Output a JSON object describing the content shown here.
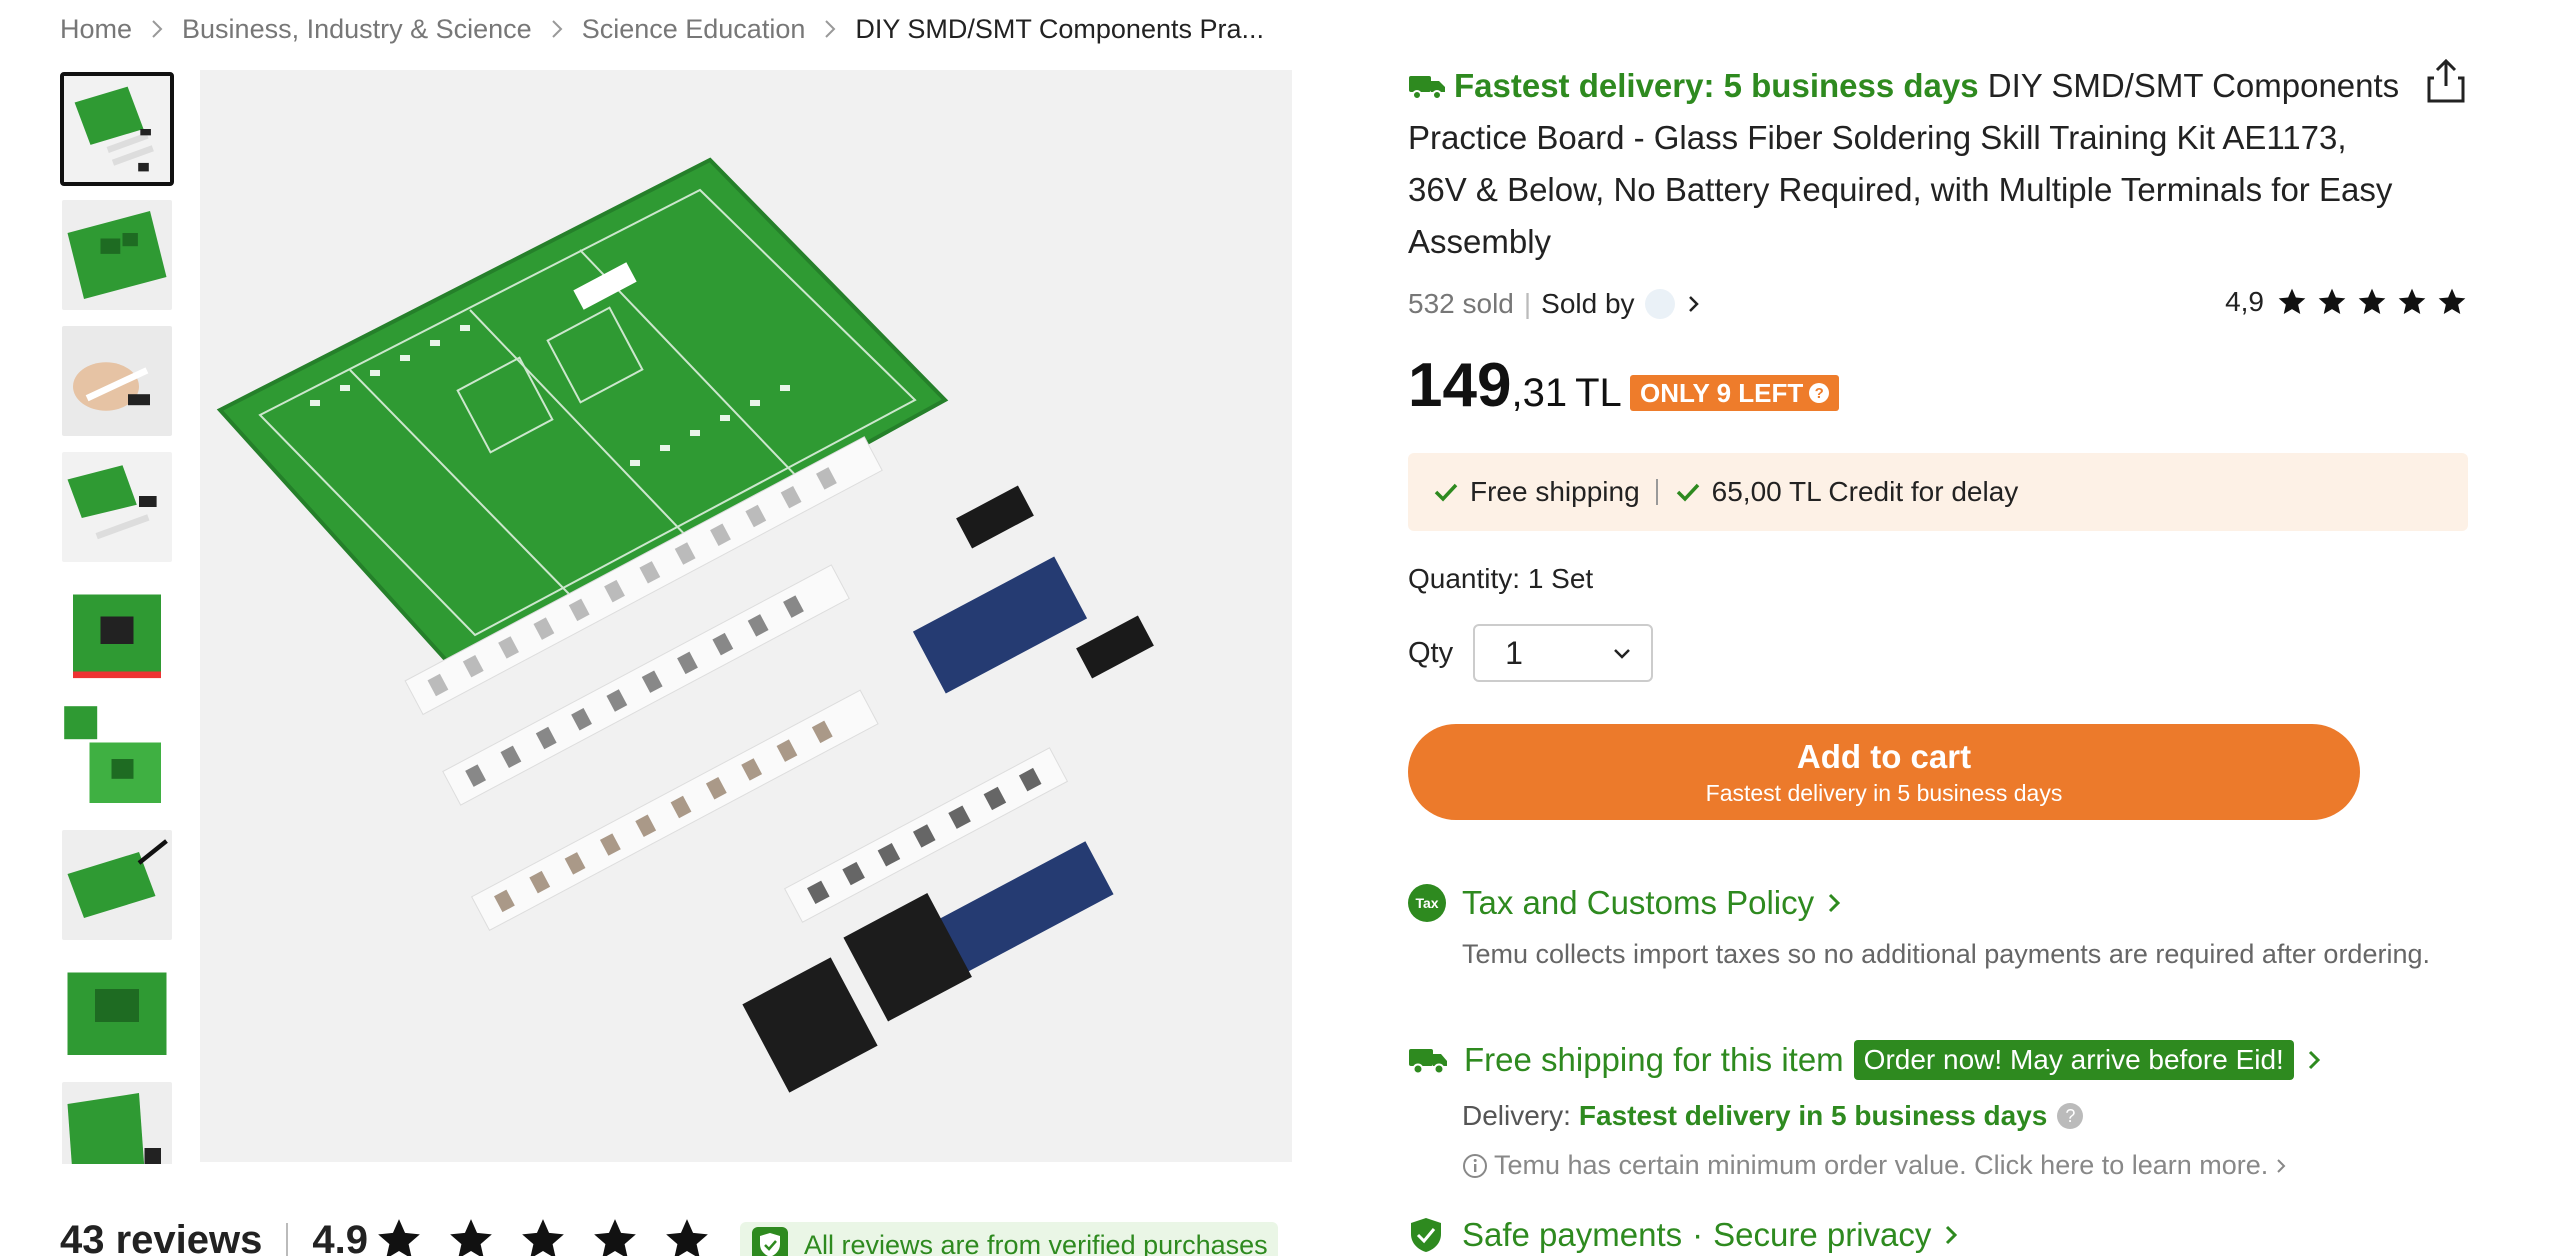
{
  "breadcrumb": {
    "items": [
      "Home",
      "Business, Industry & Science",
      "Science Education",
      "DIY SMD/SMT Components Pra..."
    ]
  },
  "product": {
    "fast_badge": "Fastest delivery: 5 business days",
    "title": "DIY SMD/SMT Components Practice Board - Glass Fiber Soldering Skill Training Kit AE1173, 36V & Below, No Battery Required, with Multiple Terminals for Easy Assembly",
    "sold": "532 sold",
    "sold_by": "Sold by",
    "rating": "4,9",
    "price_int": "149",
    "price_dec": ",31",
    "currency": "TL",
    "stock": "ONLY 9 LEFT",
    "stock_help": "?"
  },
  "shipping_box": {
    "free_shipping": "Free shipping",
    "credit": "65,00 TL Credit for delay"
  },
  "quantity": {
    "label": "Quantity: 1 Set",
    "qty_label": "Qty",
    "qty_value": "1"
  },
  "cart": {
    "label": "Add to cart",
    "sublabel": "Fastest delivery in 5 business days"
  },
  "tax": {
    "icon_text": "Tax",
    "heading": "Tax and Customs Policy",
    "body": "Temu collects import taxes so no additional payments are required after ordering."
  },
  "free_ship": {
    "heading": "Free shipping for this item",
    "badge": "Order now! May arrive before Eid!",
    "delivery_label": "Delivery:",
    "delivery_value": "Fastest delivery in 5 business days",
    "qmark": "?",
    "info": "Temu has certain minimum order value. Click here to learn more."
  },
  "safe": {
    "heading_a": "Safe payments",
    "dot": "·",
    "heading_b": "Secure privacy"
  },
  "reviews": {
    "count": "43 reviews",
    "rating": "4.9",
    "verified": "All reviews are from verified purchases"
  },
  "colors": {
    "accent_orange": "#ec7a2b",
    "green": "#2e8a1f",
    "pcb_green": "#2f9a33",
    "shipping_bg": "#fdf1e6"
  },
  "icons": [
    "chevron-right-icon",
    "truck-icon",
    "share-icon",
    "star-icon",
    "check-icon",
    "chevron-down-icon",
    "tax-icon",
    "info-icon",
    "shield-icon"
  ]
}
